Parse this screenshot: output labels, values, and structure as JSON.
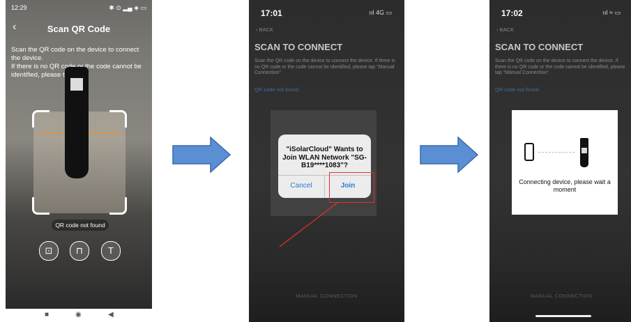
{
  "screen1": {
    "status_time": "12:29",
    "status_right": "✱ ⊙ ▂▄ ◈ ▭",
    "back_glyph": "‹",
    "title": "Scan QR Code",
    "instruction": "Scan the QR code on the device to connect the device.\nIf there is no QR code or the code cannot be identified, please tap \"T\".",
    "qr_not_found": "QR code not found",
    "buttons": [
      {
        "icon": "image-icon",
        "glyph": "⊡"
      },
      {
        "icon": "flashlight-icon",
        "glyph": "⊓"
      },
      {
        "icon": "text-input-icon",
        "glyph": "T"
      }
    ],
    "nav": {
      "square": "■",
      "circle": "◉",
      "back": "◀"
    }
  },
  "screen2": {
    "time": "17:01",
    "signal": "ııl 4G ▭",
    "back": "‹ BACK",
    "heading": "SCAN TO CONNECT",
    "description": "Scan the QR code on the device to connect the device. If there is no QR code or the code cannot be identified, please tap \"Manual Connection\".",
    "link": "QR code not found",
    "alert_message": "\"iSolarCloud\" Wants to Join WLAN Network \"SG-B19****1083\"?",
    "alert_cancel": "Cancel",
    "alert_join": "Join",
    "bottom_button": "MANUAL CONNECTION"
  },
  "screen3": {
    "time": "17:02",
    "signal": "ııl ≈ ▭",
    "back": "‹ BACK",
    "heading": "SCAN TO CONNECT",
    "description": "Scan the QR code on the device to connect the device. If there is no QR code or the code cannot be identified, please tap \"Manual Connection\".",
    "link": "QR code not found",
    "card_message": "Connecting device, please wait a moment",
    "bottom_button": "MANUAL CONNECTION"
  },
  "colors": {
    "arrow_fill": "#5b8fd4",
    "arrow_stroke": "#3a68a8",
    "link_blue": "#3f6f9a",
    "highlight_red": "#e03030",
    "scan_line": "#ff8c00"
  }
}
